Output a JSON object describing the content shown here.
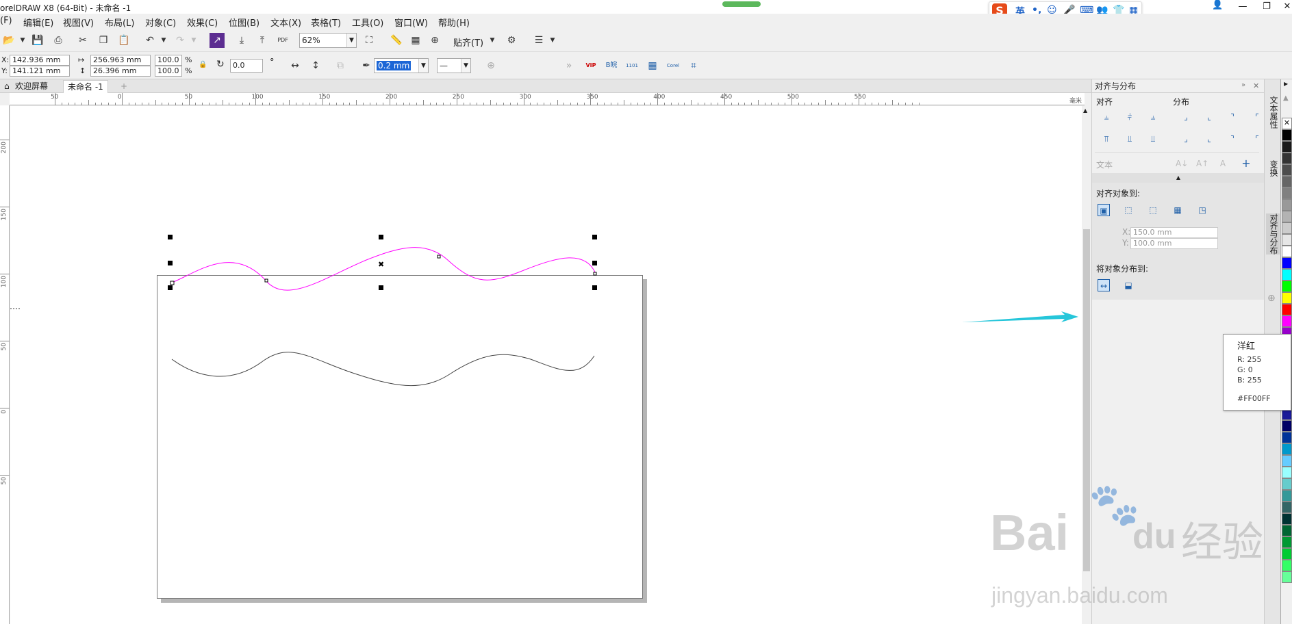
{
  "window": {
    "title": "orelDRAW X8 (64-Bit) - 未命名 -1",
    "progress_fraction": 1.0
  },
  "ime_toolbar": {
    "lang": "英"
  },
  "menu": [
    "(F)",
    "编辑(E)",
    "视图(V)",
    "布局(L)",
    "对象(C)",
    "效果(C)",
    "位图(B)",
    "文本(X)",
    "表格(T)",
    "工具(O)",
    "窗口(W)",
    "帮助(H)"
  ],
  "toolbar": {
    "zoom_value": "62%",
    "snap_label": "贴齐(T)",
    "pdf_label": "PDF"
  },
  "propbar": {
    "x_label": "X:",
    "x_value": "142.936 mm",
    "y_label": "Y:",
    "y_value": "141.121 mm",
    "w_value": "256.963 mm",
    "h_value": "26.396 mm",
    "sx_value": "100.0",
    "sy_value": "100.0",
    "pct": "%",
    "rotation_value": "0.0",
    "degree": "°",
    "outline_width": "0.2 mm",
    "plugin_labels": [
      "VIP",
      "B皖",
      "1101",
      "",
      "Corel",
      ""
    ]
  },
  "tabs": {
    "welcome": "欢迎屏幕",
    "document": "未命名 -1"
  },
  "ruler": {
    "unit": "毫米",
    "h_labels": [
      "50",
      "0",
      "50",
      "100",
      "150",
      "200",
      "250",
      "300",
      "350",
      "400",
      "450",
      "500",
      "550"
    ],
    "v_labels": [
      "200",
      "150",
      "100",
      "50",
      "0",
      "50"
    ]
  },
  "docker": {
    "title": "对齐与分布",
    "align_label": "对齐",
    "distribute_label": "分布",
    "text_label": "文本",
    "align_to_label": "对齐对象到:",
    "x_label": "X:",
    "x_value": "150.0 mm",
    "y_label": "Y:",
    "y_value": "100.0 mm",
    "distribute_to_label": "将对象分布到:"
  },
  "docker_tabs": [
    "文本属性",
    "变换",
    "对齐与分布"
  ],
  "palette": {
    "colors": [
      "#000000",
      "#1a1a1a",
      "#333333",
      "#4d4d4d",
      "#666666",
      "#808080",
      "#999999",
      "#b3b3b3",
      "#cccccc",
      "#e6e6e6",
      "#ffffff",
      "#0000ff",
      "#00ffff",
      "#00ff00",
      "#ffff00",
      "#ff0000",
      "#ff00ff",
      "#9900cc",
      "#b3b3ff",
      "#9999ff",
      "#8080ff",
      "#6666ff",
      "#4d4dff",
      "#3333cc",
      "#1a1a99",
      "#000066",
      "#003399",
      "#0099cc",
      "#66ccff",
      "#99ffff",
      "#66cccc",
      "#339999",
      "#336666",
      "#003333",
      "#006633",
      "#009933",
      "#00cc33",
      "#33ff66",
      "#66ff99"
    ]
  },
  "tooltip": {
    "name": "洋红",
    "r": "R: 255",
    "g": "G: 0",
    "b": "B: 255",
    "hex": "#FF00FF"
  },
  "watermark": {
    "brand": "Bai",
    "brand2": "du",
    "cn": "经验",
    "url": "jingyan.baidu.com"
  }
}
